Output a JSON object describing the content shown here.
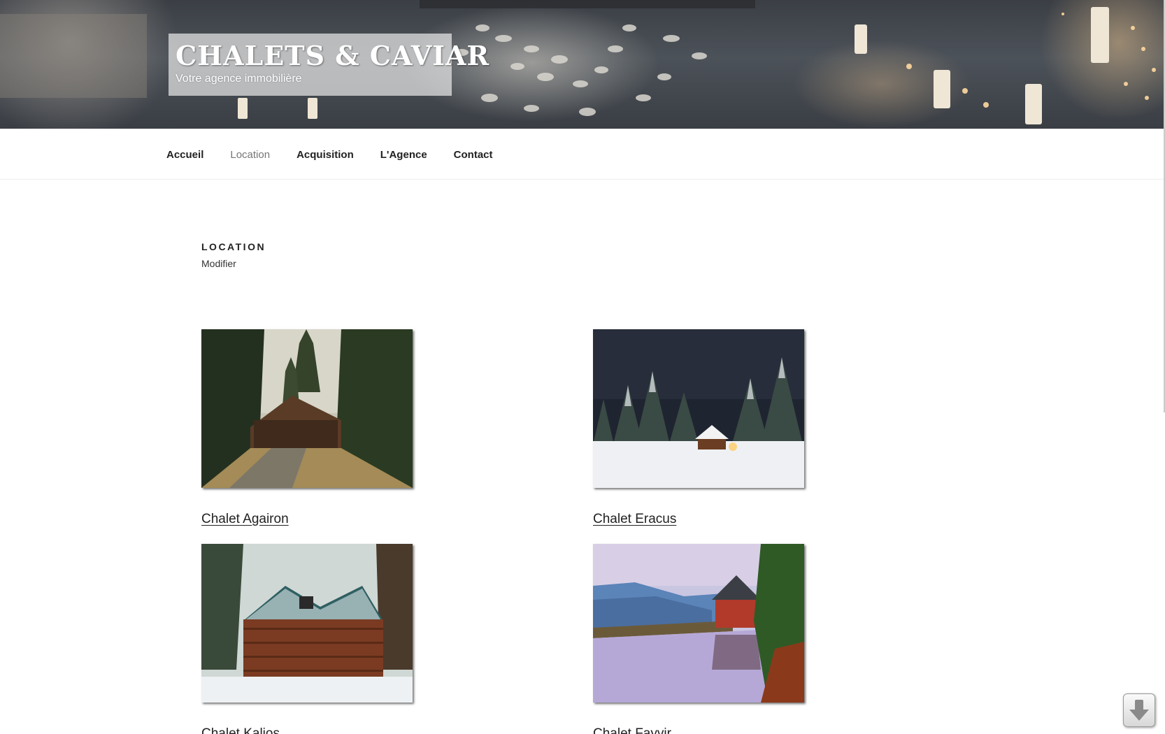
{
  "site": {
    "title": "CHALETS & CAVIAR",
    "tagline": "Votre agence immobilière"
  },
  "nav": {
    "items": [
      {
        "label": "Accueil",
        "current": false
      },
      {
        "label": "Location",
        "current": true
      },
      {
        "label": "Acquisition",
        "current": false
      },
      {
        "label": "L'Agence",
        "current": false
      },
      {
        "label": "Contact",
        "current": false
      }
    ]
  },
  "page": {
    "title": "LOCATION",
    "edit_label": "Modifier"
  },
  "properties": [
    {
      "name": "Chalet Agairon",
      "image": "forest-cabin-photo"
    },
    {
      "name": "Chalet Eracus",
      "image": "snow-night-cabin-photo"
    },
    {
      "name": "Chalet Kalios",
      "image": "snowy-log-house-photo"
    },
    {
      "name": "Chalet Fayvir",
      "image": "lake-reflection-chalet-photo"
    }
  ],
  "scroll_button": {
    "icon": "arrow-down-icon"
  },
  "colors": {
    "text": "#222222",
    "nav_current": "#767676",
    "accent_link": "#222222"
  }
}
